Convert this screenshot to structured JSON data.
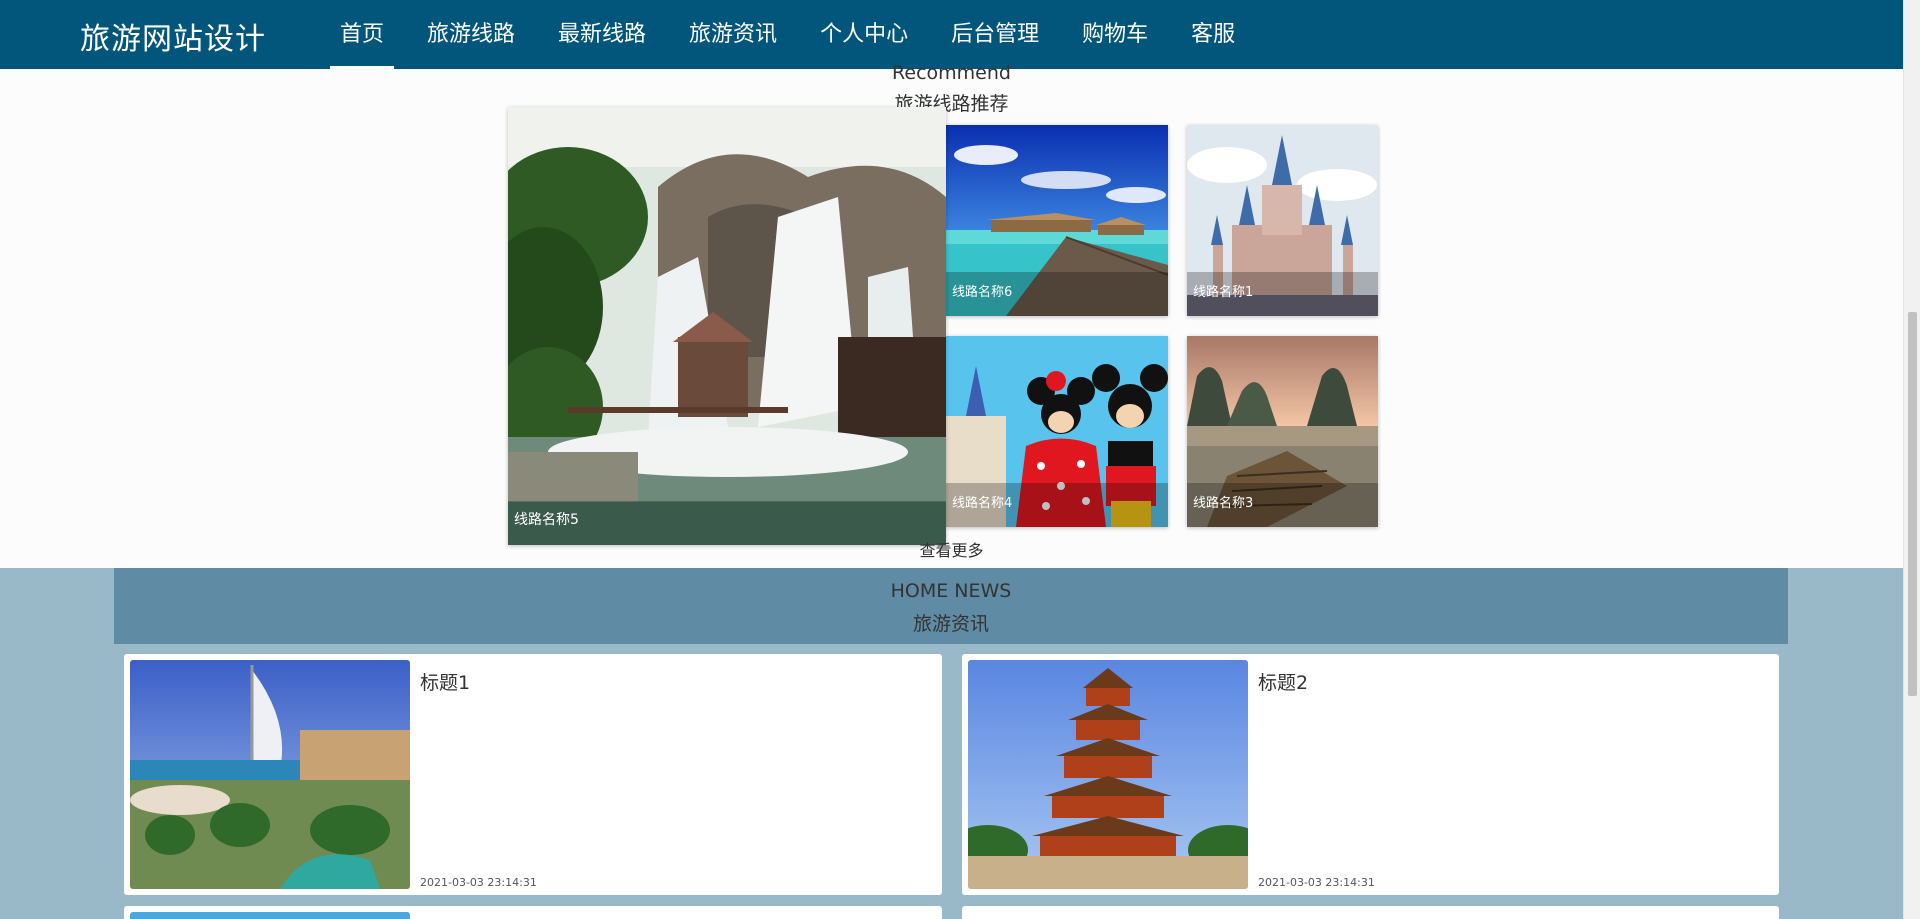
{
  "header": {
    "brand": "旅游网站设计",
    "nav": [
      {
        "label": "首页",
        "active": true
      },
      {
        "label": "旅游线路"
      },
      {
        "label": "最新线路"
      },
      {
        "label": "旅游资讯"
      },
      {
        "label": "个人中心"
      },
      {
        "label": "后台管理"
      },
      {
        "label": "购物车"
      },
      {
        "label": "客服"
      }
    ]
  },
  "recommend": {
    "title_en": "Recommend",
    "title_cn": "旅游线路推荐",
    "tiles": [
      {
        "name": "线路名称5"
      },
      {
        "name": "线路名称6"
      },
      {
        "name": "线路名称1"
      },
      {
        "name": "线路名称4"
      },
      {
        "name": "线路名称3"
      }
    ],
    "more": "查看更多"
  },
  "news": {
    "title_en": "HOME NEWS",
    "title_cn": "旅游资讯",
    "items": [
      {
        "title": "标题1",
        "date": "2021-03-03 23:14:31"
      },
      {
        "title": "标题2",
        "date": "2021-03-03 23:14:31"
      }
    ]
  },
  "colors": {
    "nav_bg": "#03567b",
    "news_bg": "#99b8c8",
    "news_header_bg": "#5f8ca4"
  }
}
